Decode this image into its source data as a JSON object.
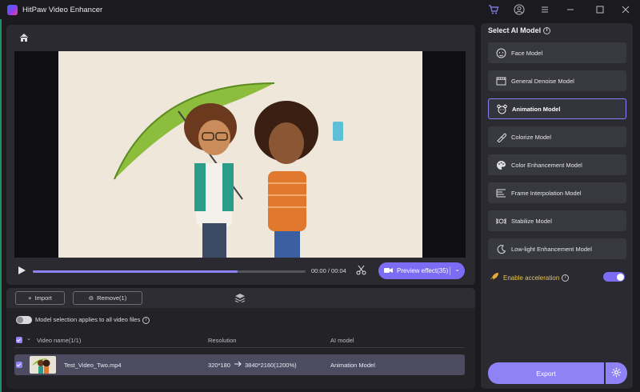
{
  "app": {
    "title": "HitPaw Video Enhancer"
  },
  "player": {
    "time": "00:00 / 00:04",
    "progress": 0.75,
    "preview_label": "Preview effect(35)"
  },
  "files": {
    "import_label": "Import",
    "remove_label": "Remove(1)",
    "apply_all_label": "Model selection applies to all video files",
    "columns": {
      "name": "Video name(1/1)",
      "resolution": "Resolution",
      "model": "AI model"
    },
    "rows": [
      {
        "name": "Test_Video_Two.mp4",
        "res_from": "320*180",
        "res_to": "3840*2160(1200%)",
        "model": "Animation Model"
      }
    ]
  },
  "models": {
    "title": "Select AI Model",
    "items": [
      {
        "label": "Face Model",
        "icon": "face-icon"
      },
      {
        "label": "General Denoise Model",
        "icon": "film-icon"
      },
      {
        "label": "Animation Model",
        "icon": "bear-icon",
        "selected": true
      },
      {
        "label": "Colorize Model",
        "icon": "brush-icon"
      },
      {
        "label": "Color Enhancement Model",
        "icon": "palette-icon"
      },
      {
        "label": "Frame Interpolation Model",
        "icon": "frames-icon"
      },
      {
        "label": "Stabilize Model",
        "icon": "stabilize-icon"
      },
      {
        "label": "Low-light Enhancement Model",
        "icon": "moon-icon"
      }
    ],
    "acceleration_label": "Enable acceleration",
    "acceleration_on": true,
    "export_label": "Export"
  },
  "colors": {
    "accent": "#7c6cf4",
    "panel": "#2a2a30",
    "bg": "#1b1b1f"
  }
}
